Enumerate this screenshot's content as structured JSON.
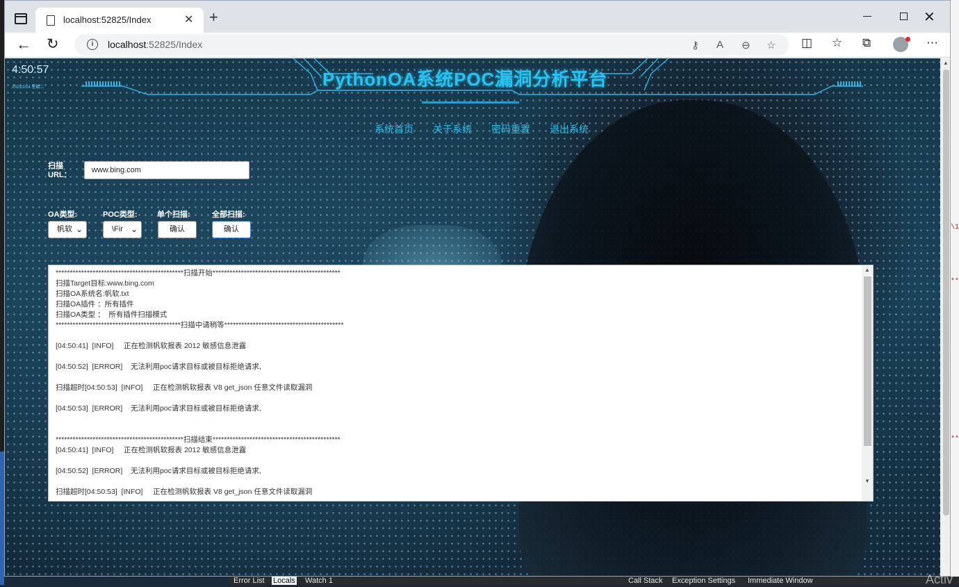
{
  "browser": {
    "tab_title": "localhost:52825/Index",
    "url_host": "localhost",
    "url_rest": ":52825/Index"
  },
  "page": {
    "clock": {
      "time": "4:50:57",
      "date": "2023/2/14 星期二"
    },
    "title": "PythonOA系统POC漏洞分析平台",
    "nav": [
      "系统首页",
      "关于系统",
      "密码重置",
      "退出系统"
    ],
    "form": {
      "url_label": "扫描URL：",
      "url_value": "www.bing.com",
      "oa_type_label": "OA类型:",
      "oa_type_value": "帆软",
      "poc_type_label": "POC类型:",
      "poc_type_value": "\\Fir",
      "single_scan_label": "单个扫描:",
      "single_scan_button": "确认",
      "all_scan_label": "全部扫描:",
      "all_scan_button": "确认"
    },
    "log_lines": [
      "*********************************************扫描开始*********************************************",
      "扫描Target目标:www.bing.com",
      "扫描OA系统名:帆软.txt",
      "扫描OA插件 ：所有插件",
      "扫描OA类型 ：  所有插件扫描模式",
      "********************************************扫描中请稍等******************************************",
      "",
      "[04:50:41]  [INFO]     正在检测帆软报表 2012 敏感信息泄露",
      "",
      "[04:50:52]  [ERROR]    无法利用poc请求目标或被目标拒绝请求,",
      "",
      "扫描超时[04:50:53]  [INFO]     正在检测帆软报表 V8 get_json 任意文件读取漏洞",
      "",
      "[04:50:53]  [ERROR]    无法利用poc请求目标或被目标拒绝请求,",
      "",
      "",
      "*********************************************扫描结束*********************************************",
      "[04:50:41]  [INFO]     正在检测帆软报表 2012 敏感信息泄露",
      "",
      "[04:50:52]  [ERROR]    无法利用poc请求目标或被目标拒绝请求,",
      "",
      "扫描超时[04:50:53]  [INFO]     正在检测帆软报表 V8 get_json 任意文件读取漏洞"
    ]
  },
  "ide_panel": {
    "tabs": [
      "Error List",
      "Locals",
      "Watch 1",
      "Call Stack",
      "Exception Settings",
      "Immediate Window"
    ],
    "watermark": "Activ"
  },
  "icons": [
    "sidebar-toggle-icon",
    "document-icon",
    "close-icon",
    "plus-icon",
    "minimize-icon",
    "maximize-icon",
    "back-arrow-icon",
    "reload-icon",
    "info-icon",
    "key-icon",
    "read-aloud-icon",
    "zoom-out-icon",
    "favorite-add-icon",
    "split-screen-icon",
    "favorites-icon",
    "collections-icon",
    "avatar-icon",
    "more-icon"
  ]
}
